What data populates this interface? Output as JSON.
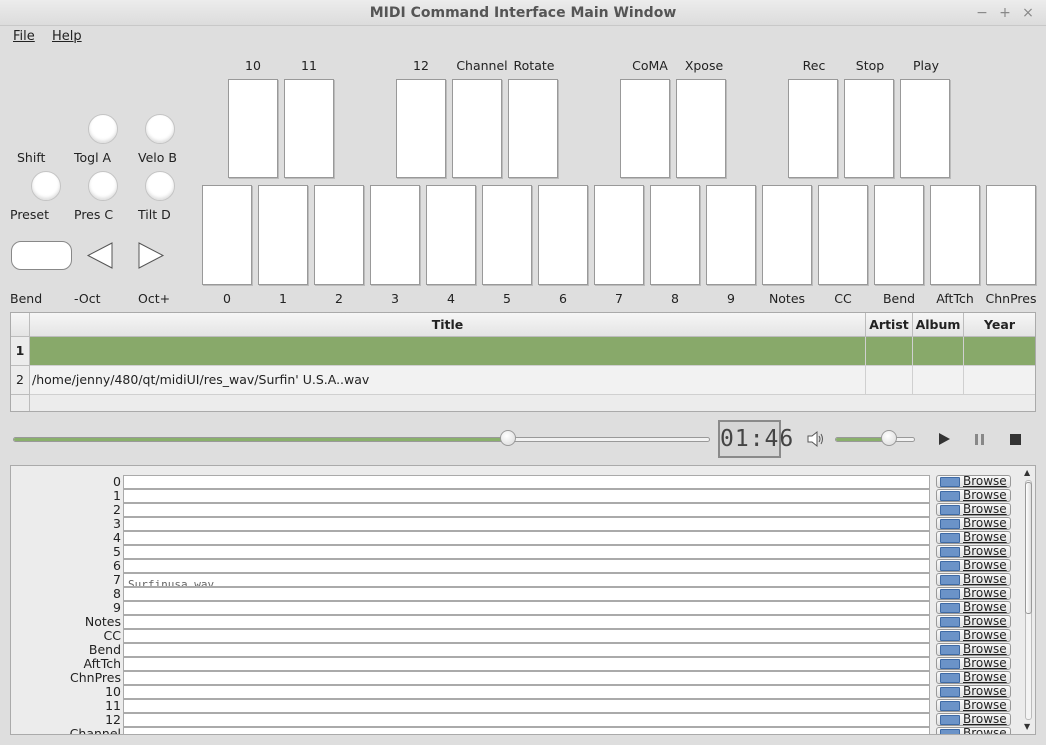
{
  "window": {
    "title": "MIDI Command Interface Main Window"
  },
  "menu": {
    "file": "File",
    "help": "Help"
  },
  "knobs": {
    "shift": "Shift",
    "togl_a": "Togl A",
    "velo_b": "Velo B",
    "preset": "Preset",
    "pres_c": "Pres C",
    "tilt_d": "Tilt D"
  },
  "controls": {
    "bend": "Bend",
    "oct_down": "-Oct",
    "oct_up": "Oct+"
  },
  "top_pads": {
    "p10": "10",
    "p11": "11",
    "p12": "12",
    "channel": "Channel",
    "rotate": "Rotate",
    "coma": "CoMA",
    "xpose": "Xpose",
    "rec": "Rec",
    "stop": "Stop",
    "play": "Play"
  },
  "bottom_pads": [
    "0",
    "1",
    "2",
    "3",
    "4",
    "5",
    "6",
    "7",
    "8",
    "9",
    "Notes",
    "CC",
    "Bend",
    "AftTch",
    "ChnPres"
  ],
  "playlist": {
    "columns": {
      "title": "Title",
      "artist": "Artist",
      "album": "Album",
      "year": "Year"
    },
    "rows": [
      {
        "num": "1",
        "title": ""
      },
      {
        "num": "2",
        "title": "/home/jenny/480/qt/midiUI/res_wav/Surfin' U.S.A..wav"
      }
    ]
  },
  "transport": {
    "time": "01:46",
    "progress": 0.71,
    "volume": 0.68
  },
  "mapping": {
    "browse_label": "Browse",
    "rows": [
      {
        "label": "0",
        "file": ""
      },
      {
        "label": "1",
        "file": ""
      },
      {
        "label": "2",
        "file": ""
      },
      {
        "label": "3",
        "file": ""
      },
      {
        "label": "4",
        "file": ""
      },
      {
        "label": "5",
        "file": ""
      },
      {
        "label": "6",
        "file": ""
      },
      {
        "label": "7",
        "file": "Surfinusa.wav"
      },
      {
        "label": "8",
        "file": ""
      },
      {
        "label": "9",
        "file": ""
      },
      {
        "label": "Notes",
        "file": ""
      },
      {
        "label": "CC",
        "file": ""
      },
      {
        "label": "Bend",
        "file": ""
      },
      {
        "label": "AftTch",
        "file": ""
      },
      {
        "label": "ChnPres",
        "file": ""
      },
      {
        "label": "10",
        "file": ""
      },
      {
        "label": "11",
        "file": ""
      },
      {
        "label": "12",
        "file": ""
      },
      {
        "label": "Channel",
        "file": ""
      }
    ]
  },
  "icons": {
    "minimize": "minimize-icon",
    "maximize": "maximize-icon",
    "close": "close-icon",
    "volume": "speaker-icon",
    "play": "play-icon",
    "pause": "pause-icon",
    "stop": "stop-icon",
    "folder": "folder-icon"
  }
}
